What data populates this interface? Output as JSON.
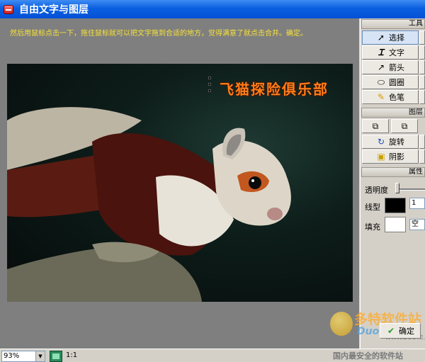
{
  "window": {
    "title": "自由文字与图层"
  },
  "canvas": {
    "hint": "然后用鼠标点击一下，拖住鼠标就可以把文字拖到合适的地方，觉得满意了就点击合并。确定。",
    "photo_caption": "飞猫探险俱乐部"
  },
  "panel": {
    "tools_header": "工具",
    "tools": [
      {
        "label": "选择",
        "icon": "cursor-arrow-icon"
      },
      {
        "label": "文字",
        "icon": "text-tool-icon"
      },
      {
        "label": "箭头",
        "icon": "arrow-icon"
      },
      {
        "label": "圆圈",
        "icon": "ellipse-icon"
      },
      {
        "label": "色笔",
        "icon": "pen-icon"
      }
    ],
    "layers_header": "图层",
    "layer_buttons": [
      {
        "label": "旋转",
        "icon": "rotate-icon"
      },
      {
        "label": "阴影",
        "icon": "shadow-icon"
      }
    ],
    "props_header": "属性",
    "opacity_label": "透明度",
    "line_label": "线型",
    "line_color": "#000000",
    "line_width": "1",
    "fill_label": "填充",
    "fill_color": "#ffffff",
    "fill_value": "空心"
  },
  "ok_button": {
    "label": "确定"
  },
  "statusbar": {
    "zoom": "93%",
    "actual_size": "1:1"
  },
  "watermark": {
    "brand": "多特软件站",
    "logo": "Duote",
    "domain": "WWW.DUOTE.COM",
    "slogan": "国内最安全的软件站"
  }
}
